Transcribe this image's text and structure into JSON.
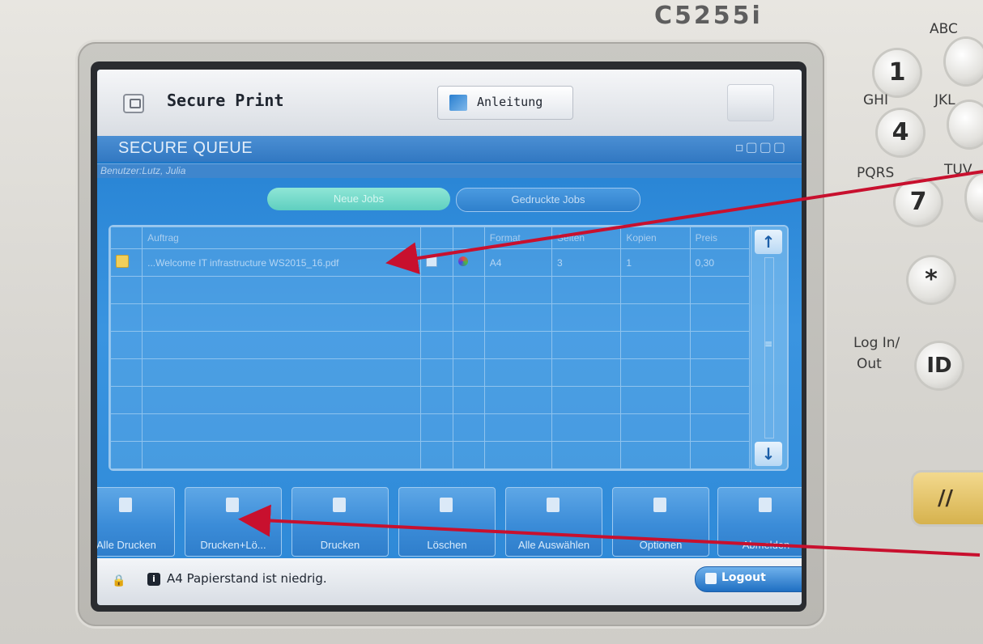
{
  "device": {
    "model": "C5255i"
  },
  "app": {
    "title": "Secure Print",
    "guide_label": "Anleitung"
  },
  "queue": {
    "title": "SECURE QUEUE",
    "user_label": "Benutzer:Lutz, Julia",
    "tabs": [
      {
        "label": "Neue Jobs",
        "selected": true
      },
      {
        "label": "Gedruckte Jobs",
        "selected": false
      }
    ]
  },
  "table": {
    "headers": {
      "job": "Auftrag",
      "format": "Format",
      "pages": "Seiten",
      "copies": "Kopien",
      "price": "Preis"
    },
    "rows": [
      {
        "job": "...Welcome IT infrastructure WS2015_16.pdf",
        "format": "A4",
        "pages": "3",
        "copies": "1",
        "price": "0,30"
      }
    ]
  },
  "actions": [
    {
      "label": "Alle Drucken",
      "icon": "print-all-icon"
    },
    {
      "label": "Drucken+Lö...",
      "icon": "print-delete-icon"
    },
    {
      "label": "Drucken",
      "icon": "print-icon"
    },
    {
      "label": "Löschen",
      "icon": "delete-icon"
    },
    {
      "label": "Alle Auswählen",
      "icon": "select-all-icon"
    },
    {
      "label": "Optionen",
      "icon": "options-icon"
    },
    {
      "label": "Abmelden",
      "icon": "signout-icon"
    }
  ],
  "status": {
    "paper_size": "A4",
    "message": "Papierstand ist niedrig.",
    "logout_label": "Logout"
  },
  "keypad": {
    "keys": [
      "1",
      "4",
      "7",
      "*",
      "ID"
    ],
    "labels": {
      "abc": "ABC",
      "ghi": "GHI",
      "jkl": "JKL",
      "pqrs": "PQRS",
      "tuv": "TUV",
      "login": "Log In/",
      "out": "Out"
    },
    "reset_symbol": "//"
  },
  "colors": {
    "screen_blue": "#1c78c8",
    "annotation_arrow": "#c8102e",
    "new_jobs_tab": "#5fcfc0"
  }
}
